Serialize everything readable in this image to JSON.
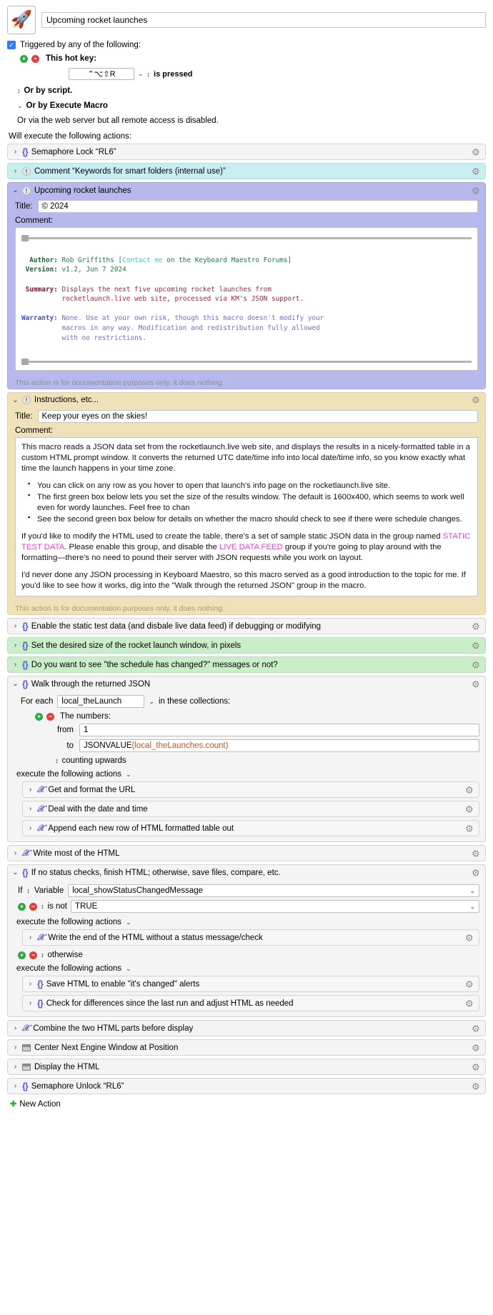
{
  "macro": {
    "icon": "rocket-icon",
    "title": "Upcoming rocket launches"
  },
  "trigger": {
    "checkbox_label": "Triggered by any of the following:",
    "hotkey_label": "This hot key:",
    "hotkey_value": "⌃⌥⇧R",
    "is_pressed_label": "is pressed",
    "or_by_script": "Or by script.",
    "or_by_execute_macro": "Or by Execute Macro",
    "web_server_note": "Or via the web server but all remote access is disabled.",
    "add_icon": "plus-circle-icon",
    "remove_icon": "minus-circle-icon",
    "check_glyph": "✓"
  },
  "will_execute_label": "Will execute the following actions:",
  "gear_icon": "gear-icon",
  "disclosure_collapsed": "›",
  "disclosure_expanded": "⌄",
  "actions": [
    {
      "title": "Semaphore Lock “RL6”",
      "color": "gray",
      "glyph": "brace-icon",
      "expanded": false
    },
    {
      "title": "Comment “Keywords for smart folders (internal use)”",
      "color": "cyan",
      "glyph": "comment-bang-icon",
      "expanded": false
    },
    {
      "title": "Upcoming rocket launches",
      "color": "purple",
      "glyph": "comment-bang-icon",
      "expanded": true
    },
    {
      "title": "Instructions, etc...",
      "color": "tan",
      "glyph": "comment-bang-icon",
      "expanded": true
    },
    {
      "title": "Enable the static test data (and disbale live data feed) if debugging or modifying",
      "color": "gray",
      "glyph": "brace-icon",
      "expanded": false
    },
    {
      "title": "Set the desired size of the rocket launch window, in pixels",
      "color": "green",
      "glyph": "brace-icon",
      "expanded": false
    },
    {
      "title": "Do you want to see \"the schedule has changed?\" messages or not?",
      "color": "green",
      "glyph": "brace-icon",
      "expanded": false
    },
    {
      "title": "Walk through the returned JSON",
      "color": "gray",
      "glyph": "brace-icon",
      "expanded": true
    },
    {
      "title": "Write most of the HTML",
      "color": "gray",
      "glyph": "x-script-icon",
      "expanded": false
    },
    {
      "title": "If no status checks, finish HTML; otherwise, save files, compare, etc.",
      "color": "gray",
      "glyph": "brace-icon",
      "expanded": true
    },
    {
      "title": "Combine the two HTML parts before display",
      "color": "gray",
      "glyph": "x-script-icon",
      "expanded": false
    },
    {
      "title": "Center Next Engine Window at Position",
      "color": "gray",
      "glyph": "window-icon",
      "expanded": false
    },
    {
      "title": "Display the HTML",
      "color": "gray",
      "glyph": "window-icon",
      "expanded": false
    },
    {
      "title": "Semaphore Unlock “RL6”",
      "color": "gray",
      "glyph": "brace-icon",
      "expanded": false
    }
  ],
  "comment_purple": {
    "title_label": "Title:",
    "title_value": "© 2024",
    "comment_label": "Comment:",
    "lines": {
      "author_key": "  Author:",
      "author_v1": " Rob Griffiths [",
      "author_link": "Contact me",
      "author_v2": " on the Keyboard Maestro Forums]",
      "version_key": " Version:",
      "version_val": " v1.2, Jun 7 2024",
      "summary_key": " Summary:",
      "summary_l1": " Displays the next five upcoming rocket launches from",
      "summary_l2": "          rocketlaunch.live web site, processed via KM's JSON support.",
      "warranty_key": "Warranty:",
      "warranty_l1": " None. Use at your own risk, though this macro doesn't modify your",
      "warranty_l2": "          macros in any way. Modification and redistribution fully allowed",
      "warranty_l3": "          with no restrictions."
    },
    "footer": "This action is for documentation purposes only, it does nothing."
  },
  "comment_tan": {
    "title_label": "Title:",
    "title_value": "Keep your eyes on the skies!",
    "comment_label": "Comment:",
    "para1": "This macro reads a JSON data set from the rocketlaunch.live web site, and displays the results in a nicely-formatted table in a custom HTML prompt window. It converts the returned UTC date/time info into local date/time info, so you know exactly what time the launch happens in your time zone.",
    "bullets": [
      "You can click on any row as you hover to open that launch's info page on the rocketlaunch.live site.",
      "The first green box below lets you set the size of the results window. The default is 1600x400, which seems to work well even for wordy launches. Feel free to chan",
      "See the second green box below for details on whether the macro should check to see if there were schedule changes."
    ],
    "para2_a": "If you'd like to modify the HTML used to create the table, there's a set of sample static JSON data in the group named ",
    "para2_hl1": "STATIC TEST DATA",
    "para2_b": ". Please enable this group, and disable the ",
    "para2_hl2": "LIVE DATA FEED",
    "para2_c": " group if you're going to play around with the formatting—there's no need to pound their server with JSON requests while you work on layout.",
    "para3": "I'd never done any JSON processing in Keyboard Maestro, so this macro served as a good introduction to the topic for me. If you'd like to see how it works, dig into the \"Walk through the returned JSON\" group in the macro.",
    "footer": "This action is for documentation purposes only, it does nothing."
  },
  "walk_group": {
    "for_each_label": "For each",
    "variable_value": "local_theLaunch",
    "in_collections_label": "in these collections:",
    "the_numbers_label": "The numbers:",
    "from_label": "from",
    "from_value": "1",
    "to_label": "to",
    "to_value_prefix": "JSONVALUE",
    "to_value_arg": "(local_theLaunches.count)",
    "counting_label": "counting upwards",
    "execute_label": "execute the following actions",
    "sub_actions": [
      {
        "title": "Get and format the URL",
        "glyph": "x-script-icon"
      },
      {
        "title": "Deal with the date and time",
        "glyph": "x-script-icon"
      },
      {
        "title": "Append each new row of HTML formatted table out",
        "glyph": "x-script-icon"
      }
    ]
  },
  "if_group": {
    "if_label": "If",
    "variable_label": "Variable",
    "variable_name": "local_showStatusChangedMessage",
    "is_not_label": "is not",
    "compare_value": "TRUE",
    "execute_label": "execute the following actions",
    "then_actions": [
      {
        "title": "Write the end of the HTML without a status message/check",
        "glyph": "x-script-icon"
      }
    ],
    "otherwise_label": "otherwise",
    "otherwise_execute_label": "execute the following actions",
    "else_actions": [
      {
        "title": "Save HTML to enable \"it's changed\" alerts",
        "glyph": "brace-icon"
      },
      {
        "title": "Check for differences since the last run and adjust HTML as needed",
        "glyph": "brace-icon"
      }
    ]
  },
  "footer": {
    "new_action_label": "New Action",
    "new_action_icon": "plus-circle-icon"
  },
  "colors": {
    "accent_blue": "#2f7cf6",
    "brace_purple": "#5b5bd6",
    "cyan_row": "#c9eef0",
    "purple_row": "#b7b9ec",
    "tan_row": "#f0e2b8",
    "green_row": "#caeec8",
    "magenta_text": "#f43fe0",
    "green_add": "#2aab3f",
    "red_remove": "#e0413b"
  }
}
